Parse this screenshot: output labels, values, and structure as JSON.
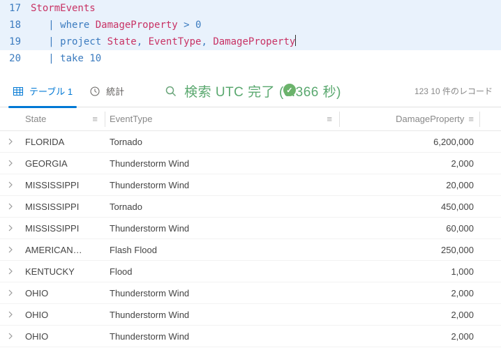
{
  "editor": {
    "lines": [
      {
        "n": "17",
        "sel": true,
        "tokens": [
          "StormEvents"
        ]
      },
      {
        "n": "18",
        "sel": true,
        "tokens": [
          "| ",
          "where ",
          "DamageProperty ",
          "> ",
          "0"
        ]
      },
      {
        "n": "19",
        "sel": true,
        "tokens": [
          "| ",
          "project ",
          "State",
          ", ",
          "EventType",
          ", ",
          "DamageProperty"
        ],
        "cursor": true
      },
      {
        "n": "20",
        "sel": false,
        "tokens": [
          "| ",
          "take ",
          "10"
        ]
      }
    ]
  },
  "tabs": {
    "table": "テーブル 1",
    "stats": "統計"
  },
  "search": {
    "placeholder": "検索 UTC 完了 (0.366 秒)",
    "page_info": "123",
    "record_info": "10 件のレコード"
  },
  "table": {
    "columns": {
      "state": "State",
      "event": "EventType",
      "damage": "DamageProperty"
    },
    "rows": [
      {
        "state": "FLORIDA",
        "event": "Tornado",
        "damage": "6,200,000"
      },
      {
        "state": "GEORGIA",
        "event": "Thunderstorm Wind",
        "damage": "2,000"
      },
      {
        "state": "MISSISSIPPI",
        "event": "Thunderstorm Wind",
        "damage": "20,000"
      },
      {
        "state": "MISSISSIPPI",
        "event": "Tornado",
        "damage": "450,000"
      },
      {
        "state": "MISSISSIPPI",
        "event": "Thunderstorm Wind",
        "damage": "60,000"
      },
      {
        "state": "AMERICAN…",
        "event": "Flash Flood",
        "damage": "250,000"
      },
      {
        "state": "KENTUCKY",
        "event": "Flood",
        "damage": "1,000"
      },
      {
        "state": "OHIO",
        "event": "Thunderstorm Wind",
        "damage": "2,000"
      },
      {
        "state": "OHIO",
        "event": "Thunderstorm Wind",
        "damage": "2,000"
      },
      {
        "state": "OHIO",
        "event": "Thunderstorm Wind",
        "damage": "2,000"
      }
    ]
  }
}
